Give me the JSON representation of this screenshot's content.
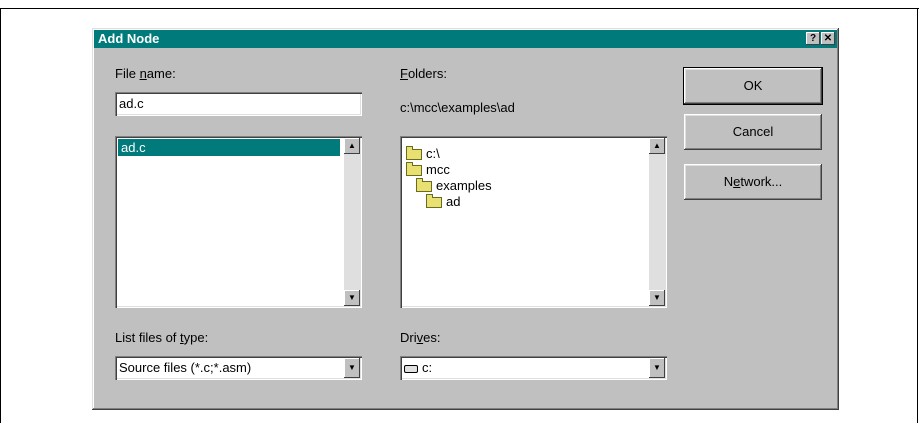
{
  "dialog": {
    "title": "Add Node",
    "help_label": "?",
    "close_label": "✕"
  },
  "file_name": {
    "label_pre": "File ",
    "label_key": "n",
    "label_post": "ame:",
    "value": "ad.c"
  },
  "file_list": {
    "items": [
      "ad.c"
    ]
  },
  "folders": {
    "label_key": "F",
    "label_post": "olders:",
    "current_path": "c:\\mcc\\examples\\ad",
    "tree": [
      "c:\\",
      "mcc",
      "examples",
      "ad"
    ]
  },
  "file_type": {
    "label_pre": "List files of ",
    "label_key": "t",
    "label_post": "ype:",
    "selected": "Source files (*.c;*.asm)"
  },
  "drives": {
    "label_pre": "Dri",
    "label_key": "v",
    "label_post": "es:",
    "selected": "c:"
  },
  "buttons": {
    "ok": "OK",
    "cancel": "Cancel",
    "network_pre": "N",
    "network_key": "e",
    "network_post": "twork..."
  },
  "icons": {
    "scroll_up": "▲",
    "scroll_down": "▼",
    "dropdown": "▼"
  },
  "colors": {
    "titlebar": "#007a7a",
    "selection": "#007a7a",
    "face": "#c0c0c0"
  }
}
